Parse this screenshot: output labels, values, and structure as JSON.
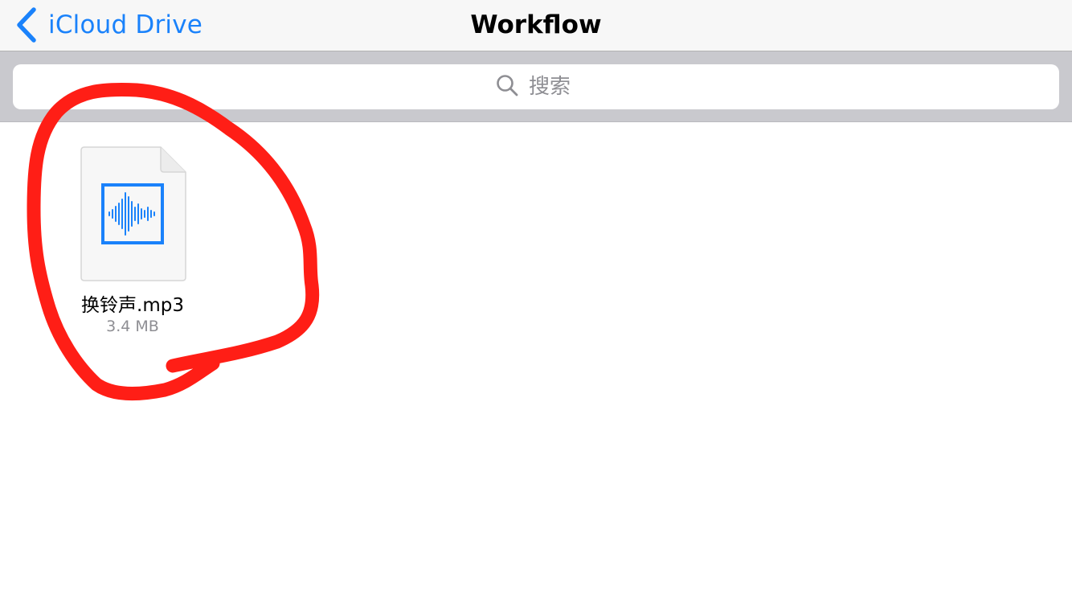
{
  "navbar": {
    "back_label": "iCloud Drive",
    "back_icon": "chevron-left-icon",
    "title": "Workflow",
    "accent_color": "#1a82fb"
  },
  "search": {
    "placeholder": "搜索",
    "value": "",
    "icon": "search-icon"
  },
  "files": [
    {
      "name": "换铃声.mp3",
      "size": "3.4 MB",
      "icon": "audio-waveform-icon",
      "icon_color": "#1a82fb"
    }
  ],
  "annotation": {
    "shape": "hand-drawn circle",
    "color": "#ff1e16"
  }
}
